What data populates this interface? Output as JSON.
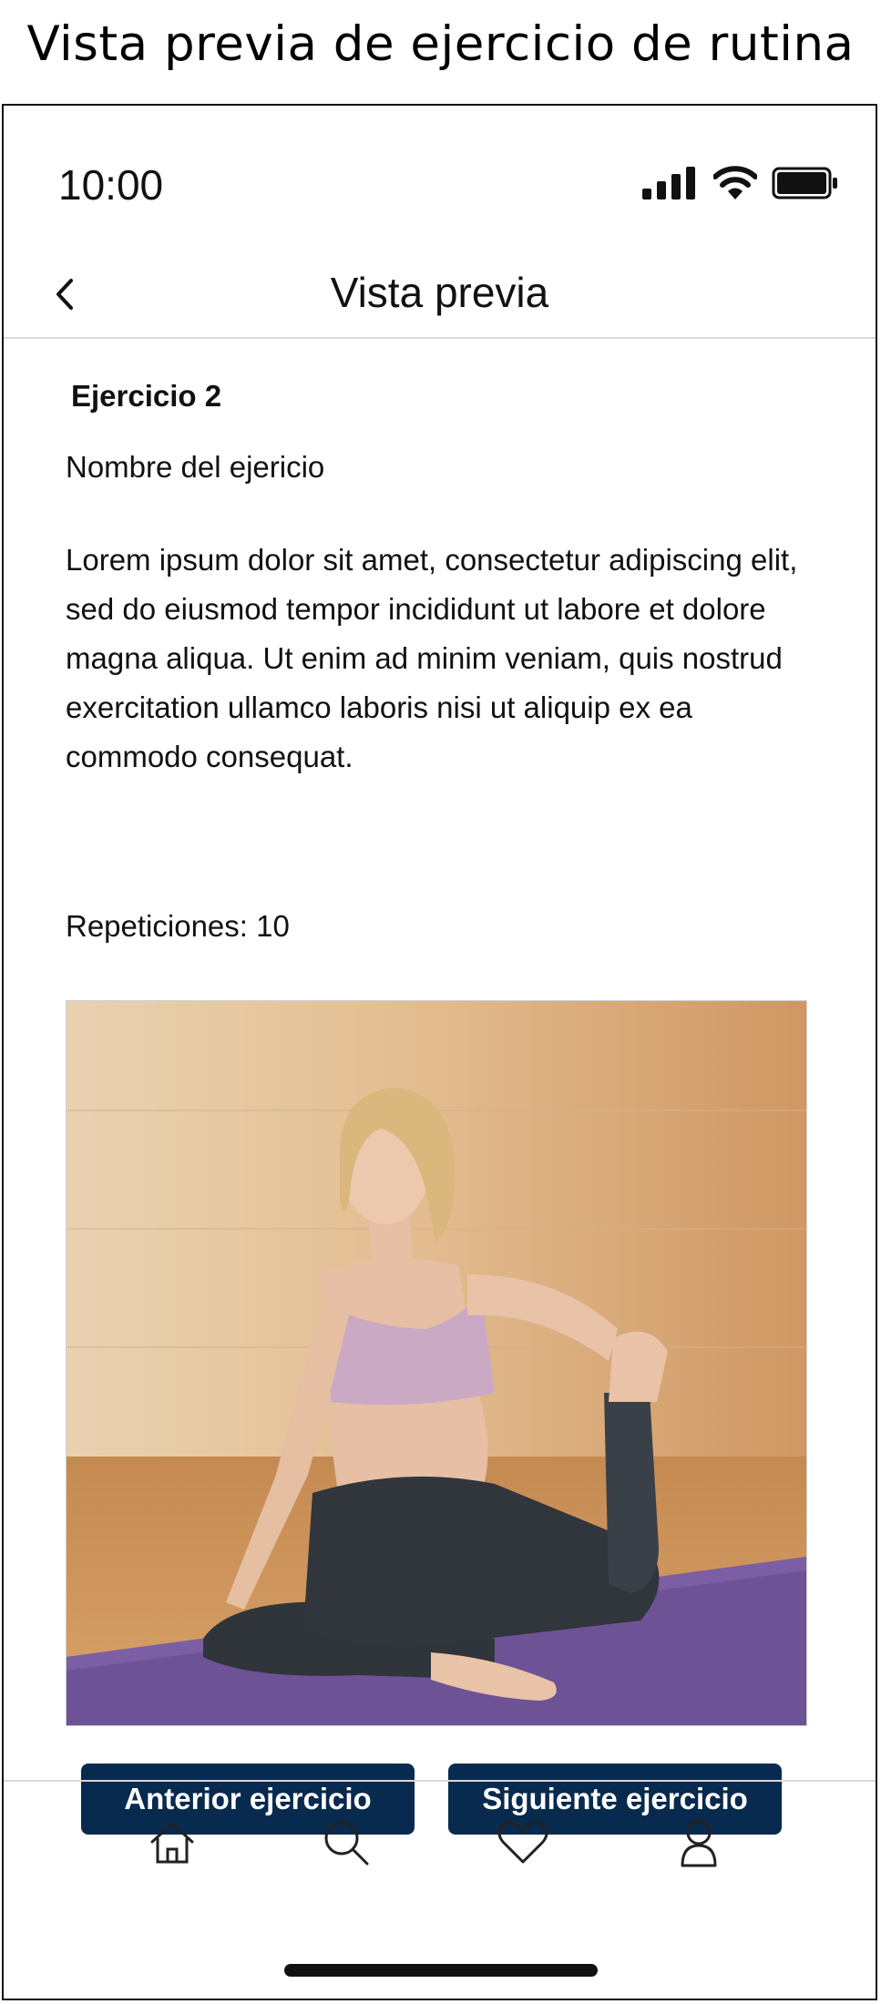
{
  "caption": "Vista previa de ejercicio de rutina",
  "status_bar": {
    "time": "10:00",
    "icons": [
      "signal-icon",
      "wifi-icon",
      "battery-icon"
    ]
  },
  "header": {
    "back_icon": "chevron-left-icon",
    "title": "Vista previa"
  },
  "exercise": {
    "number": "Ejercicio 2",
    "name": "Nombre del ejericio",
    "description": "Lorem ipsum dolor sit amet, consectetur adipiscing elit, sed do eiusmod tempor incididunt ut labore et dolore magna aliqua. Ut enim ad minim veniam, quis nostrud exercitation ullamco laboris nisi ut aliquip ex ea commodo consequat.",
    "repetitions": "Repeticiones: 10"
  },
  "buttons": {
    "previous": "Anterior ejercicio",
    "next": "Siguiente ejercicio"
  },
  "tabbar": [
    "home-icon",
    "search-icon",
    "heart-icon",
    "user-icon"
  ],
  "colors": {
    "button_bg": "#082a4e",
    "button_text": "#ffffff",
    "divider": "#d8d8d8"
  }
}
